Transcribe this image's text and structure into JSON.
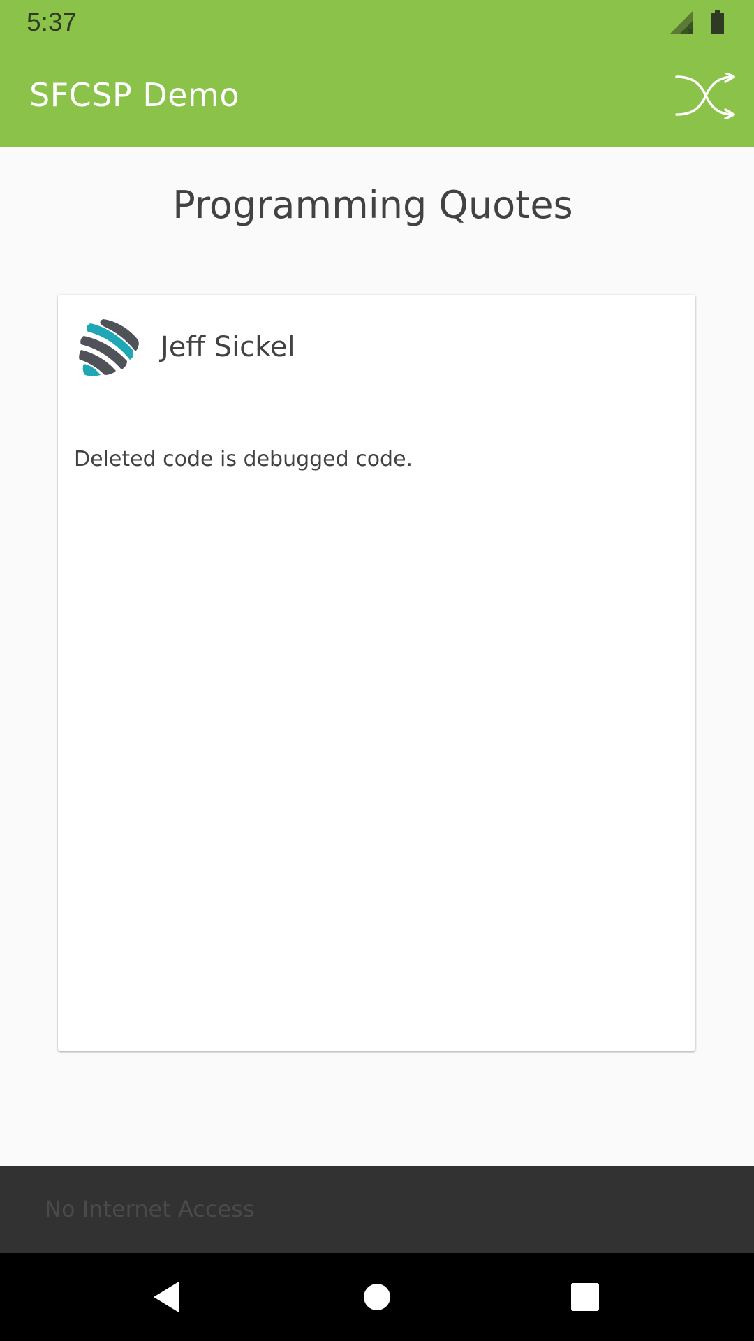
{
  "status_bar": {
    "time": "5:37",
    "icons": [
      "signal-no-data-icon",
      "battery-icon"
    ]
  },
  "app_bar": {
    "title": "SFCSP Demo",
    "action_icon": "shuffle-icon",
    "background_color": "#8bc34a"
  },
  "main": {
    "page_title": "Programming Quotes",
    "card": {
      "author": "Jeff Sickel",
      "avatar_icon": "author-avatar-logo",
      "quote": "Deleted code is debugged code."
    }
  },
  "snackbar": {
    "message": "No Internet Access"
  },
  "nav_bar": {
    "buttons": [
      "back-icon",
      "home-icon",
      "recents-icon"
    ]
  },
  "colors": {
    "accent": "#8bc34a",
    "logo_teal": "#1fa7b5",
    "logo_gray": "#4f5259"
  }
}
